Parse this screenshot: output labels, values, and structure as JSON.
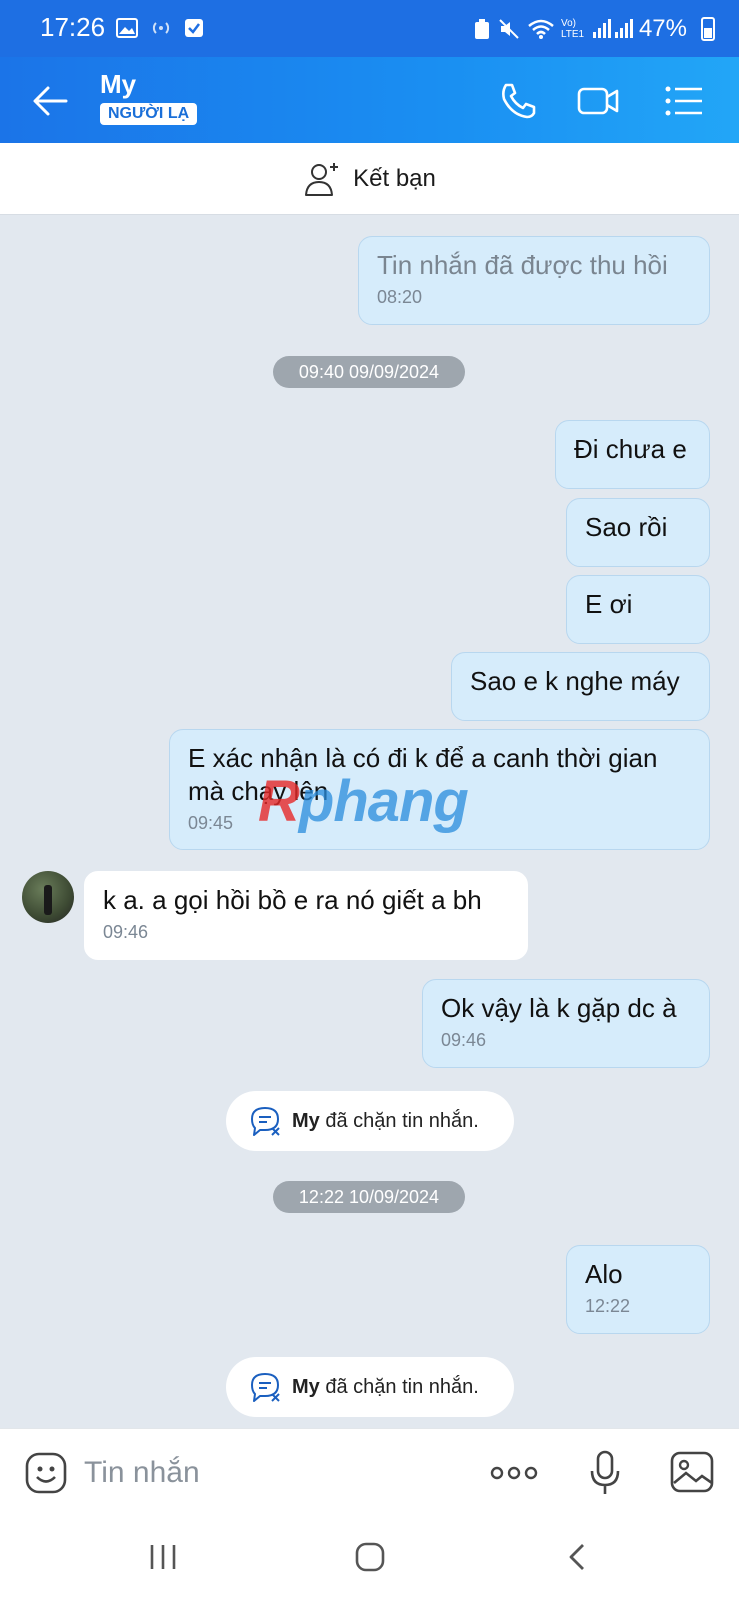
{
  "status_bar": {
    "time": "17:26",
    "battery": "47%",
    "lte": "Vo) LTE1"
  },
  "header": {
    "title": "My",
    "tag": "NGƯỜI LẠ"
  },
  "add_friend": {
    "label": "Kết bạn"
  },
  "messages": [
    {
      "dir": "out",
      "text": "Tin nhắn đã được thu hồi",
      "time": "08:20",
      "recalled": true
    },
    {
      "dir": "date",
      "text": "09:40 09/09/2024"
    },
    {
      "dir": "out",
      "text": "Đi chưa e"
    },
    {
      "dir": "out",
      "text": "Sao rồi"
    },
    {
      "dir": "out",
      "text": "E ơi"
    },
    {
      "dir": "out",
      "text": "Sao e k nghe máy"
    },
    {
      "dir": "out",
      "text": "E xác nhận là có đi k để a canh thời gian mà chạy lên",
      "time": "09:45"
    },
    {
      "dir": "in",
      "text": "k a. a gọi hồi bồ e ra nó giết a bh",
      "time": "09:46"
    },
    {
      "dir": "out",
      "text": "Ok vậy là k gặp dc à",
      "time": "09:46"
    },
    {
      "dir": "system",
      "name": "My",
      "text": "đã chặn tin nhắn."
    },
    {
      "dir": "date",
      "text": "12:22 10/09/2024"
    },
    {
      "dir": "out",
      "text": "Alo",
      "time": "12:22"
    },
    {
      "dir": "system",
      "name": "My",
      "text": "đã chặn tin nhắn."
    }
  ],
  "watermark": {
    "lead": "R",
    "rest": "phang"
  },
  "input": {
    "placeholder": "Tin nhắn"
  },
  "colors": {
    "header": "#1b74e8",
    "bubble_out": "#d6ecfb",
    "bubble_in": "#ffffff",
    "background": "#e2e8ef"
  }
}
